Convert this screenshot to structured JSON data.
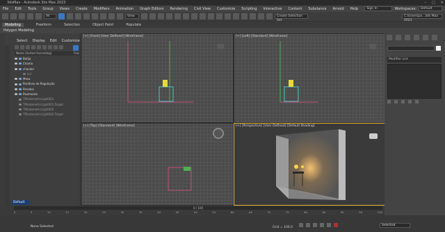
{
  "window": {
    "title": "3dsMax - Autodesk 3ds Max 2023"
  },
  "menu": {
    "items": [
      "File",
      "Edit",
      "Tools",
      "Group",
      "Views",
      "Create",
      "Modifiers",
      "Animation",
      "Graph Editors",
      "Rendering",
      "Civil View",
      "Customize",
      "Scripting",
      "Interactive",
      "Content",
      "Substance",
      "Arnold",
      "Help"
    ],
    "sign_in": "Sign In",
    "workspaces_label": "Workspaces:",
    "workspaces_value": "Default",
    "path": "C:\\Users\\pa...3ds Max 2023"
  },
  "toolbar": {
    "view_dropdown": "View",
    "selection_set": "Create Selection Set"
  },
  "ribbon": {
    "tabs": [
      "Modeling",
      "Freeform",
      "Selection",
      "Object Paint",
      "Populate"
    ],
    "active_tab": "Modeling",
    "sub_label": "Polygon Modeling"
  },
  "scene_explorer": {
    "tabs": [
      "Select",
      "Display",
      "Edit",
      "Customize"
    ],
    "header": "Name (Sorted Ascending)",
    "header_right": "Froz",
    "items": [
      {
        "label": "Botija",
        "sub": false
      },
      {
        "label": "Chama",
        "sub": false
      },
      {
        "label": "chanéol",
        "sub": false
      },
      {
        "label": "Lid",
        "sub": true
      },
      {
        "label": "Mesa",
        "sub": false
      },
      {
        "label": "Parafuso de Regulação",
        "sub": false
      },
      {
        "label": "Paredes",
        "sub": false
      },
      {
        "label": "Pavimento",
        "sub": false
      },
      {
        "label": "TPhotometricLight001",
        "sub": true
      },
      {
        "label": "TPhotometricLight001.Target",
        "sub": true
      },
      {
        "label": "TPhotometricLight002",
        "sub": true
      },
      {
        "label": "TPhotometricLight002.Target",
        "sub": true
      }
    ],
    "layer": "Default"
  },
  "viewports": {
    "front": "[+] [Front] [User Defined] [Wireframe]",
    "left": "[+] [Left] [Standard] [Wireframe]",
    "top": "[+] [Top] [Standard] [Wireframe]",
    "perspective": "[+] [Perspective] [User Defined] [Default Shading]"
  },
  "command_panel": {
    "modifier_list": "Modifier List"
  },
  "timeline": {
    "slider": "0 / 100",
    "ticks": [
      "0",
      "5",
      "10",
      "15",
      "20",
      "25",
      "30",
      "35",
      "40",
      "45",
      "50",
      "55",
      "60",
      "65",
      "70",
      "75",
      "80",
      "85",
      "90",
      "95",
      "100"
    ]
  },
  "status": {
    "selection": "None Selected",
    "grid": "Grid = 100,0",
    "selected_dropdown": "Selected"
  },
  "colors": {
    "accent": "#3a78c4",
    "front_line": "#c1507a",
    "top_box": "#c1507a",
    "green": "#4caf50"
  }
}
